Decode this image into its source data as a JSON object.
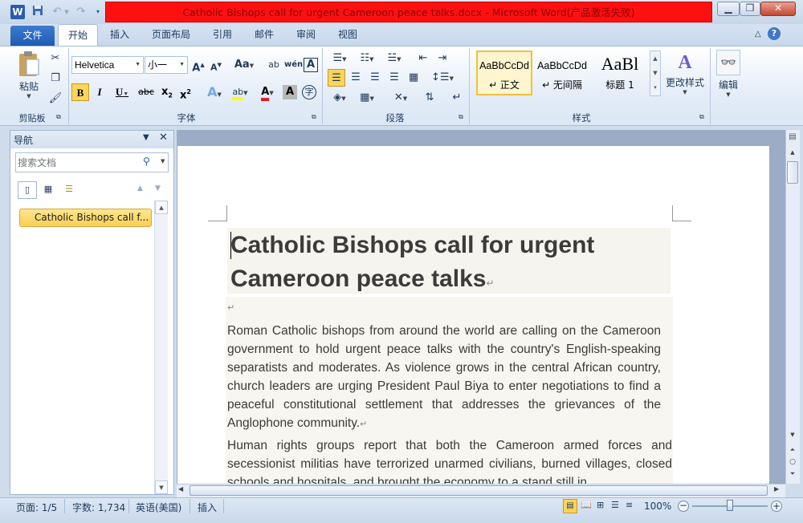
{
  "window": {
    "title": "Catholic Bishops call for urgent Cameroon peace talks.docx -  Microsoft Word(产品激活失败)",
    "app_icon": "W",
    "controls": {
      "minimize": "▁",
      "restore": "❐",
      "close": "✕"
    }
  },
  "tabs": [
    {
      "label": "文件"
    },
    {
      "label": "开始"
    },
    {
      "label": "插入"
    },
    {
      "label": "页面布局"
    },
    {
      "label": "引用"
    },
    {
      "label": "邮件"
    },
    {
      "label": "审阅"
    },
    {
      "label": "视图"
    }
  ],
  "ribbon": {
    "clipboard": {
      "paste_label": "粘贴",
      "group_label": "剪贴板"
    },
    "font": {
      "font_name": "Helvetica",
      "font_size": "小一",
      "group_label": "字体"
    },
    "paragraph": {
      "group_label": "段落"
    },
    "styles": {
      "group_label": "样式",
      "items": [
        {
          "preview": "AaBbCcDd",
          "name": "↵ 正文"
        },
        {
          "preview": "AaBbCcDd",
          "name": "↵ 无间隔"
        },
        {
          "preview": "AaBl",
          "name": "标题 1"
        }
      ],
      "change_styles_label": "更改样式"
    },
    "editing": {
      "label": "编辑"
    }
  },
  "nav": {
    "title": "导航",
    "search_placeholder": "搜索文档",
    "heading_item": "Catholic Bishops call f..."
  },
  "document": {
    "title": "Catholic Bishops call for urgent Cameroon peace talks",
    "para_mark": "↵",
    "paragraphs": [
      "Roman Catholic bishops from around the world are calling on the Cameroon government to hold urgent peace talks with the country's English-speaking separatists and moderates. As violence grows in the central African country, church leaders are urging President Paul Biya to enter negotiations to find a peaceful constitutional settlement that addresses the grievances of the Anglophone community.",
      "Human rights groups report that both the Cameroon armed forces and secessionist militias have terrorized unarmed civilians, burned villages, closed schools and hospitals, and brought the economy to a stand still in"
    ]
  },
  "status": {
    "page": "页面: 1/5",
    "words": "字数: 1,734",
    "language": "英语(美国)",
    "insert_mode": "插入",
    "zoom": "100%"
  },
  "colors": {
    "title_bar_alert": "#ff1010",
    "file_tab": "#2a63b8",
    "nav_highlight": "#fbd55b"
  }
}
